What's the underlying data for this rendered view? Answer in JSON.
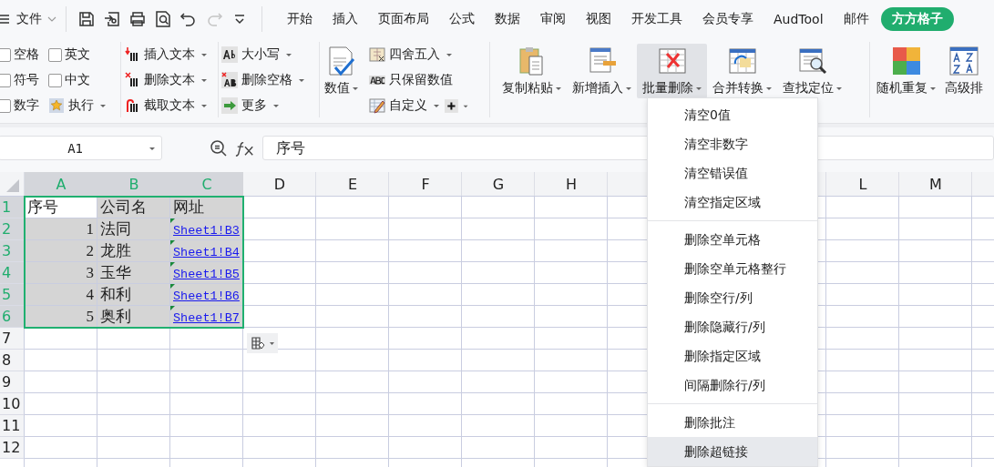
{
  "menu_button": {
    "label": "文件"
  },
  "quick_access": [
    {
      "kind": "save",
      "disabled": false
    },
    {
      "kind": "export",
      "disabled": false
    },
    {
      "kind": "print",
      "disabled": false
    },
    {
      "kind": "preview",
      "disabled": false
    },
    {
      "kind": "undo",
      "disabled": false
    },
    {
      "kind": "redo",
      "disabled": true
    },
    {
      "kind": "more",
      "disabled": false
    }
  ],
  "tabs": [
    {
      "label": "开始",
      "selected": false
    },
    {
      "label": "插入",
      "selected": false
    },
    {
      "label": "页面布局",
      "selected": false
    },
    {
      "label": "公式",
      "selected": false
    },
    {
      "label": "数据",
      "selected": false
    },
    {
      "label": "审阅",
      "selected": false
    },
    {
      "label": "视图",
      "selected": false
    },
    {
      "label": "开发工具",
      "selected": false
    },
    {
      "label": "会员专享",
      "selected": false
    },
    {
      "label": "AudTool",
      "selected": false
    },
    {
      "label": "邮件",
      "selected": false
    },
    {
      "label": "方方格子",
      "selected": true
    }
  ],
  "ribbon": {
    "filter_options": [
      {
        "label": "空格",
        "checked": false
      },
      {
        "label": "英文",
        "checked": false
      },
      {
        "label": "符号",
        "checked": false
      },
      {
        "label": "中文",
        "checked": false
      },
      {
        "label": "数字",
        "checked": false
      }
    ],
    "execute": {
      "label": "执行"
    },
    "text_tools": [
      {
        "label": "插入文本",
        "kind": "insert"
      },
      {
        "label": "删除文本",
        "kind": "delete"
      },
      {
        "label": "截取文本",
        "kind": "extract"
      }
    ],
    "case_tools": [
      {
        "label": "大小写",
        "kind": "case"
      },
      {
        "label": "删除空格",
        "kind": "trim"
      },
      {
        "label": "更多",
        "kind": "more"
      }
    ],
    "number": {
      "label": "数值"
    },
    "number_tools": [
      {
        "label": "四舍五入",
        "kind": "round",
        "dropdown": true
      },
      {
        "label": "只保留数值",
        "kind": "keep",
        "dropdown": false
      },
      {
        "label": "自定义",
        "kind": "custom",
        "dropdown": true
      }
    ],
    "big_tools": [
      {
        "label": "复制粘贴",
        "kind": "paste",
        "selected": false,
        "dropdown": true
      },
      {
        "label": "新增插入",
        "kind": "insert",
        "selected": false,
        "dropdown": true
      },
      {
        "label": "批量删除",
        "kind": "delete",
        "selected": true,
        "dropdown": true
      },
      {
        "label": "合并转换",
        "kind": "merge",
        "selected": false,
        "dropdown": true
      },
      {
        "label": "查找定位",
        "kind": "find",
        "selected": false,
        "dropdown": true
      }
    ],
    "extra_tools": [
      {
        "label": "随机重复",
        "kind": "random",
        "dropdown": true
      },
      {
        "label": "高级排",
        "kind": "sort",
        "dropdown": false
      }
    ]
  },
  "formula_bar": {
    "cell": "A1",
    "content": "序号"
  },
  "sheet": {
    "columns": [
      {
        "label": "A",
        "selected": true
      },
      {
        "label": "B",
        "selected": true
      },
      {
        "label": "C",
        "selected": true
      },
      {
        "label": "D",
        "selected": false
      },
      {
        "label": "E",
        "selected": false
      },
      {
        "label": "F",
        "selected": false
      },
      {
        "label": "G",
        "selected": false
      },
      {
        "label": "H",
        "selected": false
      },
      {
        "label": "L",
        "selected": false
      },
      {
        "label": "M",
        "selected": false
      }
    ],
    "rows": [
      {
        "label": "1",
        "selected": true,
        "cells": [
          {
            "text": "序号",
            "kind": "text",
            "selected": true,
            "active": true,
            "flagged": false
          },
          {
            "text": "公司名",
            "kind": "text",
            "selected": true,
            "active": false,
            "flagged": false
          },
          {
            "text": "网址",
            "kind": "text",
            "selected": true,
            "active": false,
            "flagged": false
          }
        ]
      },
      {
        "label": "2",
        "selected": true,
        "cells": [
          {
            "text": "1",
            "kind": "number",
            "selected": true,
            "active": false,
            "flagged": false
          },
          {
            "text": "法同",
            "kind": "text",
            "selected": true,
            "active": false,
            "flagged": false
          },
          {
            "text": "Sheet1!B3",
            "kind": "link",
            "selected": true,
            "active": false,
            "flagged": true
          }
        ]
      },
      {
        "label": "3",
        "selected": true,
        "cells": [
          {
            "text": "2",
            "kind": "number",
            "selected": true,
            "active": false,
            "flagged": false
          },
          {
            "text": "龙胜",
            "kind": "text",
            "selected": true,
            "active": false,
            "flagged": false
          },
          {
            "text": "Sheet1!B4",
            "kind": "link",
            "selected": true,
            "active": false,
            "flagged": true
          }
        ]
      },
      {
        "label": "4",
        "selected": true,
        "cells": [
          {
            "text": "3",
            "kind": "number",
            "selected": true,
            "active": false,
            "flagged": false
          },
          {
            "text": "玉华",
            "kind": "text",
            "selected": true,
            "active": false,
            "flagged": false
          },
          {
            "text": "Sheet1!B5",
            "kind": "link",
            "selected": true,
            "active": false,
            "flagged": true
          }
        ]
      },
      {
        "label": "5",
        "selected": true,
        "cells": [
          {
            "text": "4",
            "kind": "number",
            "selected": true,
            "active": false,
            "flagged": false
          },
          {
            "text": "和利",
            "kind": "text",
            "selected": true,
            "active": false,
            "flagged": false
          },
          {
            "text": "Sheet1!B6",
            "kind": "link",
            "selected": true,
            "active": false,
            "flagged": true
          }
        ]
      },
      {
        "label": "6",
        "selected": true,
        "cells": [
          {
            "text": "5",
            "kind": "number",
            "selected": true,
            "active": false,
            "flagged": false
          },
          {
            "text": "奥利",
            "kind": "text",
            "selected": true,
            "active": false,
            "flagged": false
          },
          {
            "text": "Sheet1!B7",
            "kind": "link",
            "selected": true,
            "active": false,
            "flagged": true
          }
        ]
      },
      {
        "label": "7",
        "selected": false
      },
      {
        "label": "8",
        "selected": false
      },
      {
        "label": "9",
        "selected": false
      },
      {
        "label": "10",
        "selected": false
      },
      {
        "label": "11",
        "selected": false
      },
      {
        "label": "12",
        "selected": false
      }
    ]
  },
  "dropdown_menu": {
    "items": [
      {
        "kind": "item",
        "label": "清空0值",
        "selected": false
      },
      {
        "kind": "item",
        "label": "清空非数字",
        "selected": false
      },
      {
        "kind": "item",
        "label": "清空错误值",
        "selected": false
      },
      {
        "kind": "item",
        "label": "清空指定区域",
        "selected": false
      },
      {
        "kind": "separator"
      },
      {
        "kind": "item",
        "label": "删除空单元格",
        "selected": false
      },
      {
        "kind": "item",
        "label": "删除空单元格整行",
        "selected": false
      },
      {
        "kind": "item",
        "label": "删除空行/列",
        "selected": false
      },
      {
        "kind": "item",
        "label": "删除隐藏行/列",
        "selected": false
      },
      {
        "kind": "item",
        "label": "删除指定区域",
        "selected": false
      },
      {
        "kind": "item",
        "label": "间隔删除行/列",
        "selected": false
      },
      {
        "kind": "separator"
      },
      {
        "kind": "item",
        "label": "删除批注",
        "selected": false
      },
      {
        "kind": "item",
        "label": "删除超链接",
        "selected": true
      }
    ]
  }
}
